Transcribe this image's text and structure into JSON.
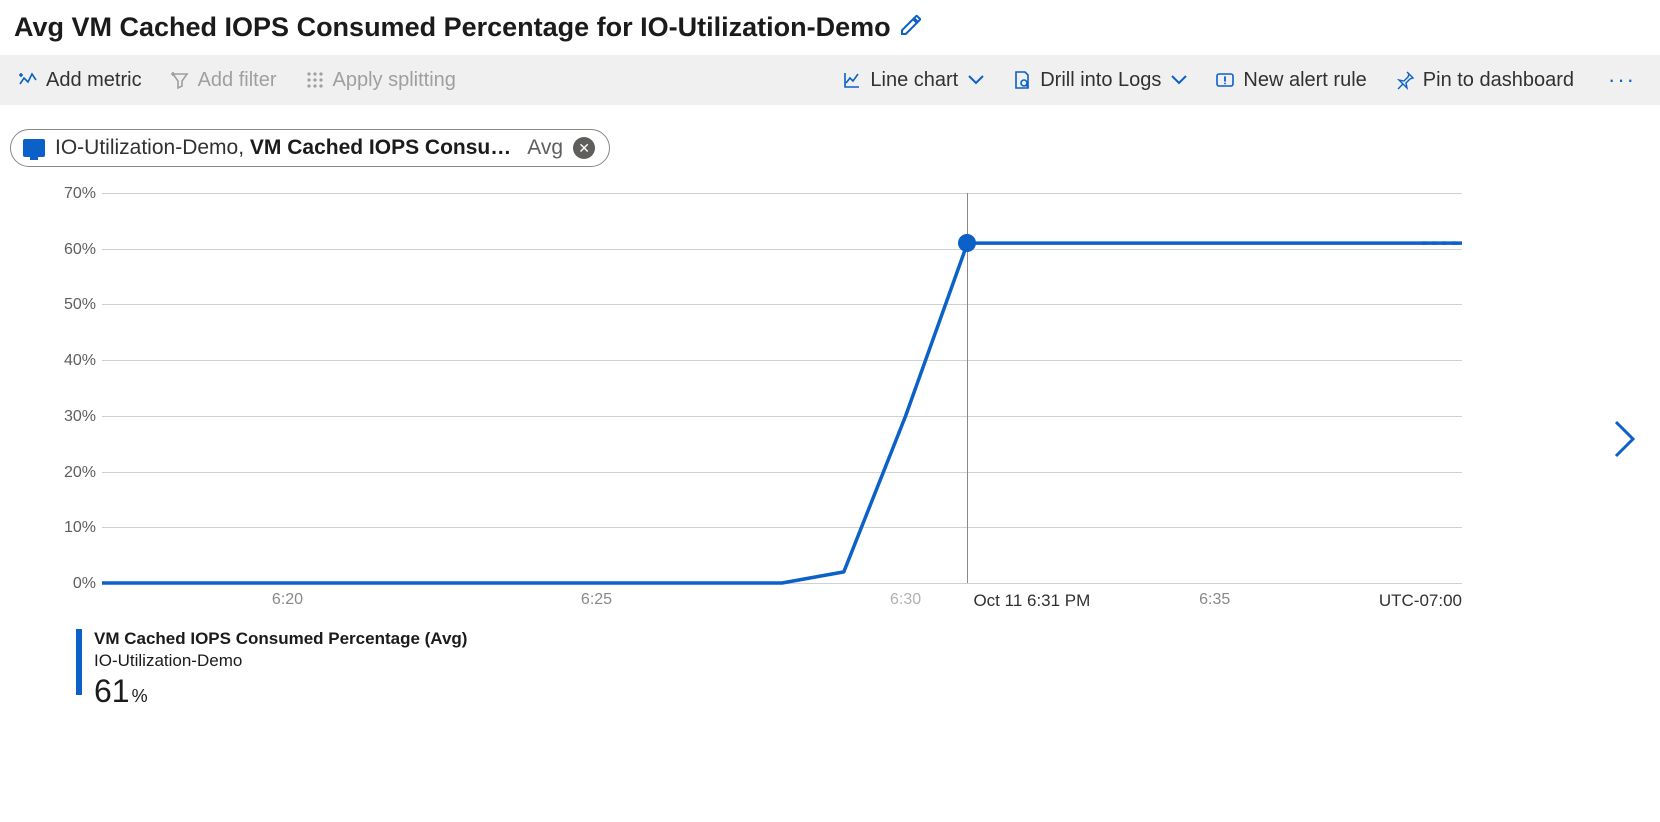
{
  "header": {
    "title": "Avg VM Cached IOPS Consumed Percentage for IO-Utilization-Demo"
  },
  "toolbar": {
    "add_metric": "Add metric",
    "add_filter": "Add filter",
    "apply_splitting": "Apply splitting",
    "line_chart": "Line chart",
    "drill_logs": "Drill into Logs",
    "new_alert": "New alert rule",
    "pin_dashboard": "Pin to dashboard"
  },
  "chip": {
    "resource": "IO-Utilization-Demo, ",
    "metric": "VM Cached IOPS Consu…",
    "agg": "Avg"
  },
  "chart_data": {
    "type": "line",
    "x": [
      "6:17",
      "6:18",
      "6:19",
      "6:20",
      "6:21",
      "6:22",
      "6:23",
      "6:24",
      "6:25",
      "6:26",
      "6:27",
      "6:28",
      "6:29",
      "6:30",
      "6:31",
      "6:32",
      "6:33",
      "6:34",
      "6:35",
      "6:36",
      "6:37",
      "6:38",
      "6:39"
    ],
    "series": [
      {
        "name": "VM Cached IOPS Consumed Percentage (Avg)",
        "values": [
          0,
          0,
          0,
          0,
          0,
          0,
          0,
          0,
          0,
          0,
          0,
          0,
          2,
          30,
          61,
          61,
          61,
          61,
          61,
          61,
          61,
          61,
          61
        ]
      }
    ],
    "ylim": [
      0,
      70
    ],
    "yticks": [
      0,
      10,
      20,
      30,
      40,
      50,
      60,
      70
    ],
    "xticks": [
      "6:20",
      "6:25",
      "6:30",
      "6:35"
    ],
    "timezone": "UTC-07:00",
    "cursor_time": "6:31",
    "cursor_label": "Oct 11 6:31 PM",
    "cursor_value": 61
  },
  "legend": {
    "title": "VM Cached IOPS Consumed Percentage (Avg)",
    "sub": "IO-Utilization-Demo",
    "value": "61",
    "unit": "%"
  },
  "axis": {
    "y0": "0%",
    "y10": "10%",
    "y20": "20%",
    "y30": "30%",
    "y40": "40%",
    "y50": "50%",
    "y60": "60%",
    "y70": "70%",
    "x620": "6:20",
    "x625": "6:25",
    "x630": "6:30",
    "x635": "6:35"
  }
}
